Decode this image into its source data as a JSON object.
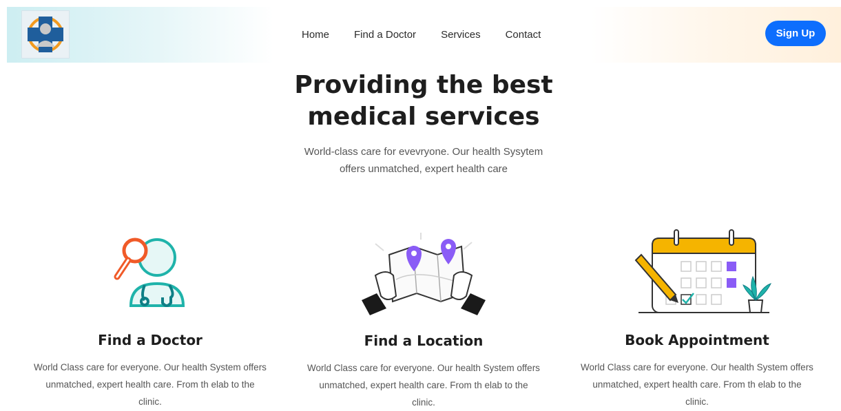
{
  "header": {
    "logo_icon": "doctor-cross-logo-icon",
    "nav": [
      "Home",
      "Find a Doctor",
      "Services",
      "Contact"
    ],
    "signup_label": "Sign Up",
    "accent_color": "#0d6efd"
  },
  "hero": {
    "title_line1": "Providing the best",
    "title_line2": "medical services",
    "subtitle_line1": "World-class care for evevryone. Our health Sysytem",
    "subtitle_line2": "offers unmatched, expert health care"
  },
  "cards": [
    {
      "icon": "doctor-search-icon",
      "title": "Find a Doctor",
      "desc_line1": "World Class care for everyone. Our health System offers",
      "desc_line2": "unmatched, expert health care. From th elab to the",
      "desc_line3": "clinic."
    },
    {
      "icon": "map-location-icon",
      "title": "Find a Location",
      "desc_line1": "World Class care for everyone. Our health System offers",
      "desc_line2": "unmatched, expert health care. From th elab to the",
      "desc_line3": "clinic."
    },
    {
      "icon": "calendar-appointment-icon",
      "title": "Book Appointment",
      "desc_line1": "World Class care for everyone. Our health System offers",
      "desc_line2": "unmatched, expert health care. From th elab to the",
      "desc_line3": "clinic."
    }
  ]
}
